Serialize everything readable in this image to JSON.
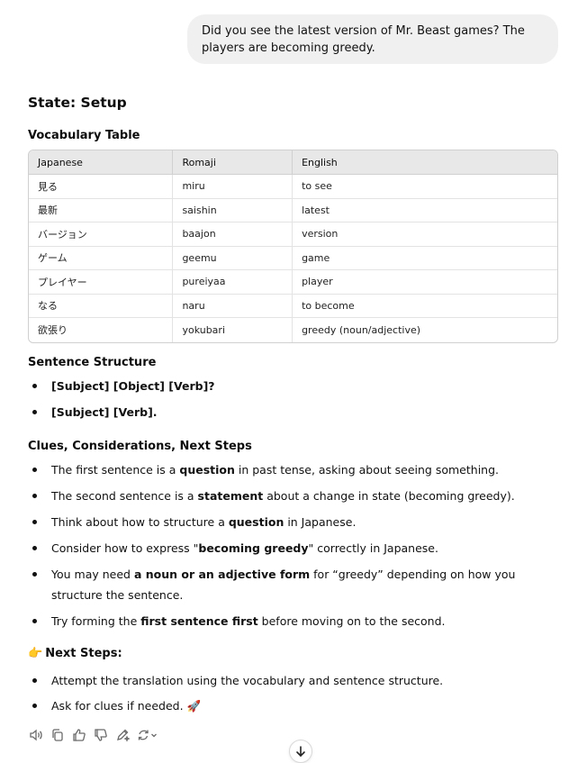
{
  "user_message": "Did you see the latest version of Mr. Beast games? The players are becoming greedy.",
  "state_title": "State: Setup",
  "vocab": {
    "heading": "Vocabulary Table",
    "columns": [
      "Japanese",
      "Romaji",
      "English"
    ],
    "rows": [
      [
        "見る",
        "miru",
        "to see"
      ],
      [
        "最新",
        "saishin",
        "latest"
      ],
      [
        "バージョン",
        "baajon",
        "version"
      ],
      [
        "ゲーム",
        "geemu",
        "game"
      ],
      [
        "プレイヤー",
        "pureiyaa",
        "player"
      ],
      [
        "なる",
        "naru",
        "to become"
      ],
      [
        "欲張り",
        "yokubari",
        "greedy (noun/adjective)"
      ]
    ]
  },
  "sentence_structure": {
    "heading": "Sentence Structure",
    "items": [
      "[Subject] [Object] [Verb]?",
      "[Subject] [Verb]."
    ]
  },
  "clues": {
    "heading": "Clues, Considerations, Next Steps",
    "items": [
      {
        "pre": "The first sentence is a ",
        "bold": "question",
        "post": " in past tense, asking about seeing something."
      },
      {
        "pre": "The second sentence is a ",
        "bold": "statement",
        "post": " about a change in state (becoming greedy)."
      },
      {
        "pre": "Think about how to structure a ",
        "bold": "question",
        "post": " in Japanese."
      },
      {
        "pre": "Consider how to express \"",
        "bold": "becoming greedy",
        "post": "\" correctly in Japanese."
      },
      {
        "pre": "You may need ",
        "bold": "a noun or an adjective form",
        "post": " for “greedy” depending on how you structure the sentence."
      },
      {
        "pre": "Try forming the ",
        "bold": "first sentence first",
        "post": " before moving on to the second."
      }
    ]
  },
  "next_steps": {
    "emoji": "👉",
    "heading": "Next Steps:",
    "items": [
      "Attempt the translation using the vocabulary and sentence structure.",
      "Ask for clues if needed. 🚀"
    ]
  },
  "icons": {
    "read_aloud": "speaker-icon",
    "copy": "copy-icon",
    "thumbs_up": "thumbs-up-icon",
    "thumbs_down": "thumbs-down-icon",
    "edit": "edit-icon",
    "regenerate": "regenerate-icon",
    "scroll_down": "arrow-down-icon"
  }
}
